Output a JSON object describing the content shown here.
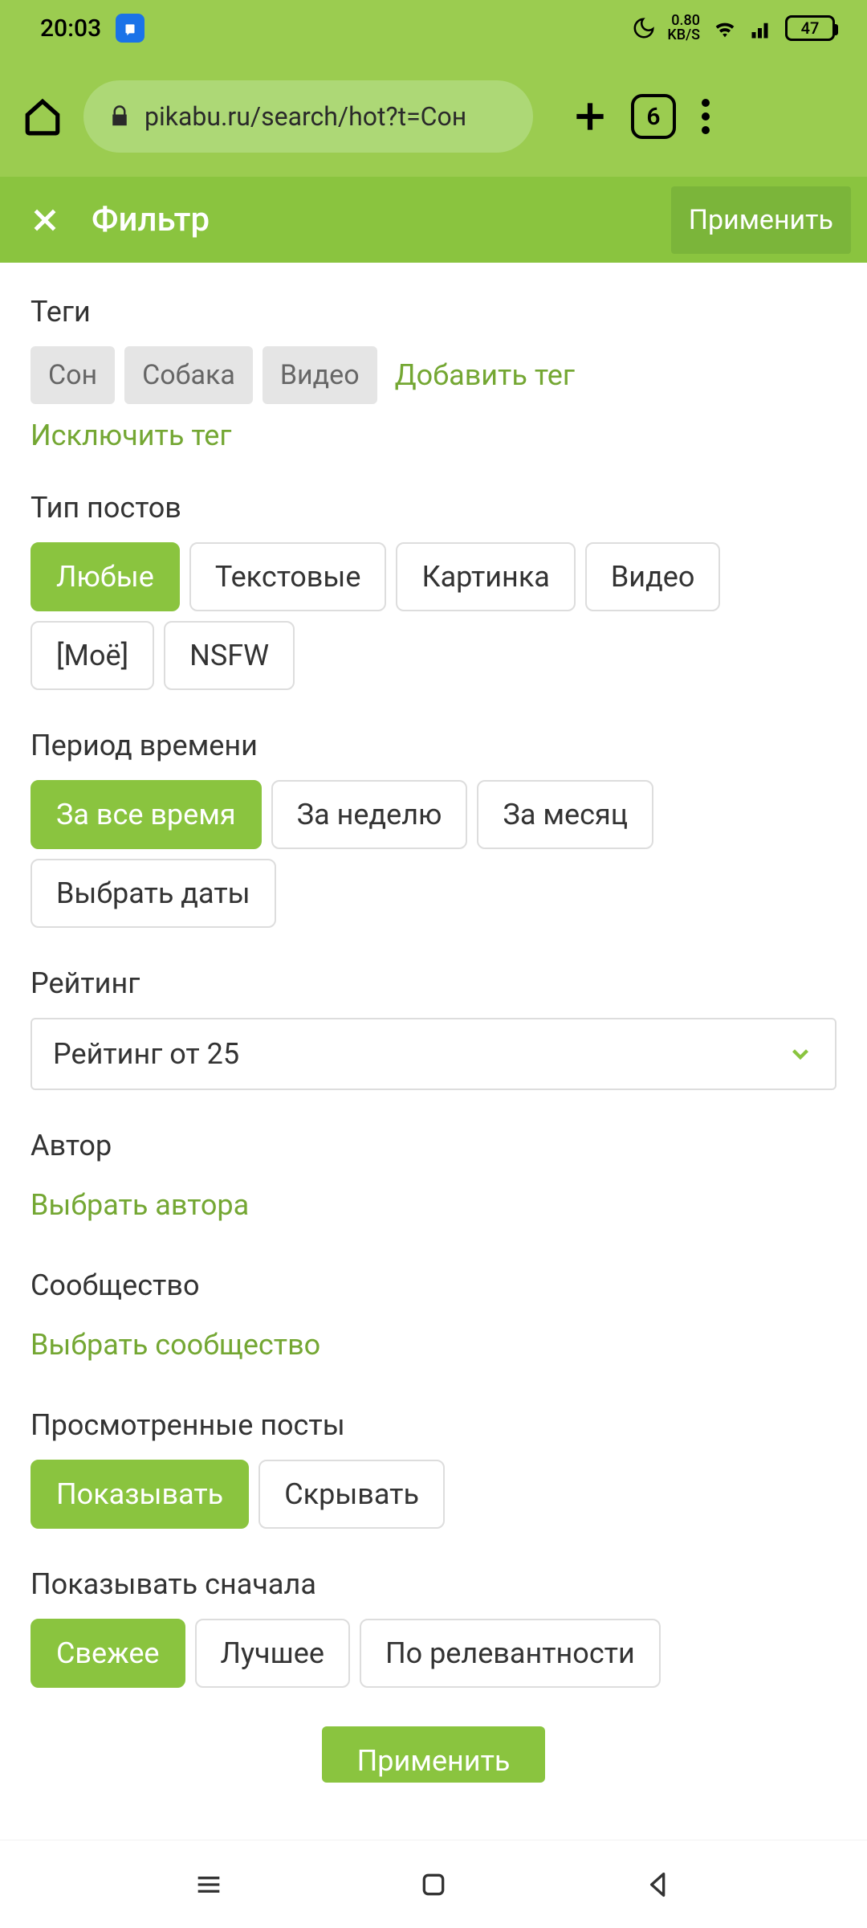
{
  "status": {
    "time": "20:03",
    "net_speed_top": "0.80",
    "net_speed_bot": "KB/S",
    "battery": "47"
  },
  "browser": {
    "url": "pikabu.ru/search/hot?t=Сон",
    "tabs": "6"
  },
  "header": {
    "title": "Фильтр",
    "apply": "Применить"
  },
  "tags": {
    "label": "Теги",
    "items": [
      "Сон",
      "Собака",
      "Видео"
    ],
    "add": "Добавить тег",
    "exclude": "Исключить тег"
  },
  "post_type": {
    "label": "Тип постов",
    "items": [
      "Любые",
      "Текстовые",
      "Картинка",
      "Видео",
      "[Моё]",
      "NSFW"
    ],
    "active": 0
  },
  "period": {
    "label": "Период времени",
    "items": [
      "За все время",
      "За неделю",
      "За месяц",
      "Выбрать даты"
    ],
    "active": 0
  },
  "rating": {
    "label": "Рейтинг",
    "value": "Рейтинг от 25"
  },
  "author": {
    "label": "Автор",
    "select": "Выбрать автора"
  },
  "community": {
    "label": "Сообщество",
    "select": "Выбрать сообщество"
  },
  "viewed": {
    "label": "Просмотренные посты",
    "items": [
      "Показывать",
      "Скрывать"
    ],
    "active": 0
  },
  "sort": {
    "label": "Показывать сначала",
    "items": [
      "Свежее",
      "Лучшее",
      "По релевантности"
    ],
    "active": 0
  },
  "bottom_apply": "Применить"
}
